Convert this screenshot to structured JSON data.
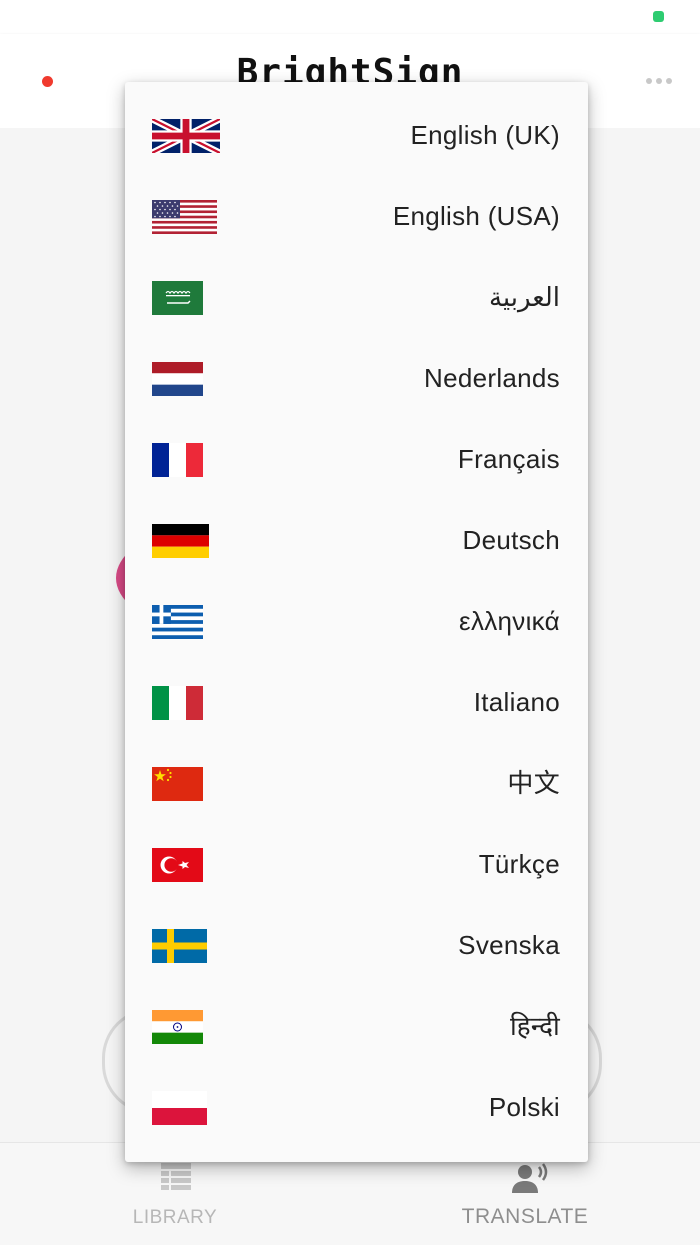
{
  "app": {
    "title": "BrightSign"
  },
  "colors": {
    "recording_dot": "#f03a2e",
    "accent_pink": "#d84a86",
    "battery": "#2ecc71"
  },
  "language_menu": {
    "items": [
      {
        "label": "English (UK)",
        "flag": "uk-flag-icon"
      },
      {
        "label": "English (USA)",
        "flag": "usa-flag-icon"
      },
      {
        "label": "العربية",
        "flag": "saudi-arabia-flag-icon"
      },
      {
        "label": "Nederlands",
        "flag": "netherlands-flag-icon"
      },
      {
        "label": "Français",
        "flag": "france-flag-icon"
      },
      {
        "label": "Deutsch",
        "flag": "germany-flag-icon"
      },
      {
        "label": "ελληνικά",
        "flag": "greece-flag-icon"
      },
      {
        "label": "Italiano",
        "flag": "italy-flag-icon"
      },
      {
        "label": "中文",
        "flag": "china-flag-icon"
      },
      {
        "label": "Türkçe",
        "flag": "turkey-flag-icon"
      },
      {
        "label": "Svenska",
        "flag": "sweden-flag-icon"
      },
      {
        "label": "हिन्दी",
        "flag": "india-flag-icon"
      },
      {
        "label": "Polski",
        "flag": "poland-flag-icon"
      }
    ]
  },
  "bottom_nav": {
    "library_label": "LIBRARY",
    "translate_label": "TRANSLATE"
  }
}
